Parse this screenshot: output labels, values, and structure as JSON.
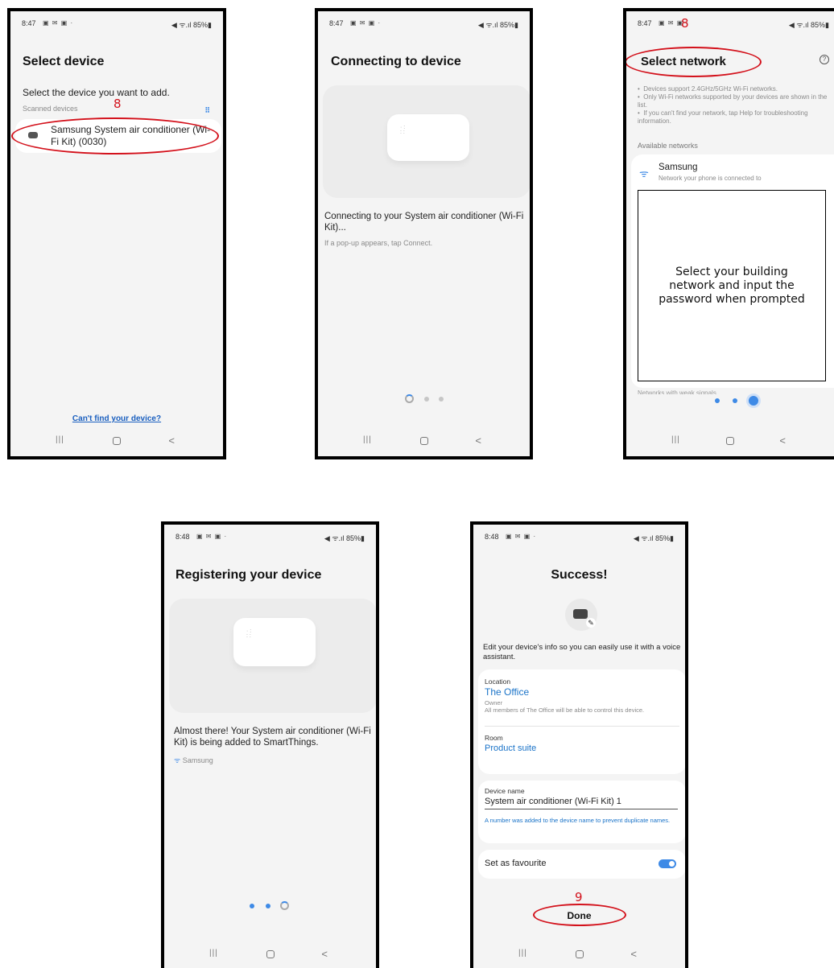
{
  "status_bar": {
    "time_847": "8:47",
    "time_848": "8:48",
    "status_icons": "▣ ✉ ▣ ·",
    "right_a": "◀ ᯤ.ıl 85%▮",
    "right_b": "◀ ᯤ.ıl 85%▮",
    "battery": "85%"
  },
  "nav": {
    "recent": "|||",
    "back": "<"
  },
  "screen1": {
    "title": "Select device",
    "prompt": "Select the device you want to add.",
    "section": "Scanned devices",
    "device_name": "Samsung System air conditioner (Wi-Fi Kit) (0030)",
    "cant_find": "Can't find your device?",
    "annotation": "8"
  },
  "screen2": {
    "title": "Connecting to device",
    "message": "Connecting to your System air conditioner (Wi-Fi Kit)...",
    "hint": "If a pop-up appears, tap Connect."
  },
  "screen3": {
    "title": "Select network",
    "help": "?",
    "bullets": [
      "Devices support 2.4GHz/5GHz Wi-Fi networks.",
      "Only Wi-Fi networks supported by your devices are shown in the list.",
      "If you can't find your network, tap Help for troubleshooting information."
    ],
    "available": "Available networks",
    "network_name": "Samsung",
    "network_sub": "Network your phone is connected to",
    "callout": "Select your building network and input the password when prompted",
    "weak": "Networks with weak signals",
    "annotation": "8"
  },
  "screen4": {
    "title": "Registering your device",
    "message": "Almost there! Your System air conditioner (Wi-Fi Kit) is being added to SmartThings.",
    "network": "Samsung"
  },
  "screen5": {
    "title": "Success!",
    "info": "Edit your device's info so you can easily use it with a voice assistant.",
    "location_label": "Location",
    "location_value": "The Office",
    "owner_label": "Owner",
    "owner_note": "All members of The Office will be able to control this device.",
    "room_label": "Room",
    "room_value": "Product suite",
    "device_name_label": "Device name",
    "device_name_value": "System air conditioner (Wi-Fi Kit) 1",
    "device_name_note": "A number was added to the device name to prevent duplicate names.",
    "favourite_label": "Set as favourite",
    "favourite_on": true,
    "done": "Done",
    "annotation": "9"
  },
  "colors": {
    "annotation": "#d3111b",
    "accent": "#1a73c8",
    "toggle": "#3e8ae6"
  }
}
